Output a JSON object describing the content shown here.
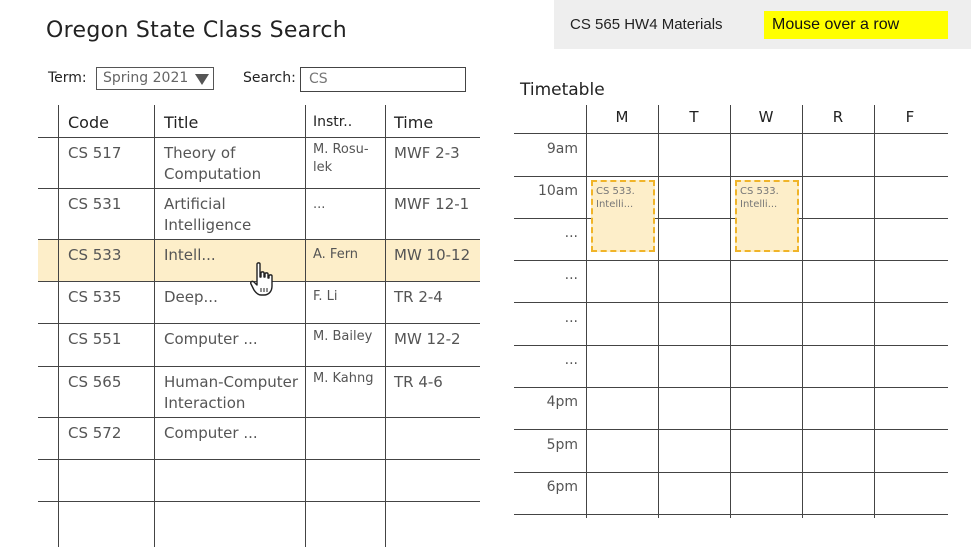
{
  "app": {
    "title": "Oregon State Class Search"
  },
  "info": {
    "hw_label": "CS 565 HW4 Materials",
    "hint": "Mouse over a row"
  },
  "filters": {
    "term_label": "Term:",
    "term_value": "Spring 2021",
    "search_label": "Search:",
    "search_value": "CS"
  },
  "table": {
    "headers": [
      "Code",
      "Title",
      "Instr..",
      "Time"
    ],
    "rows": [
      {
        "code": "CS 517",
        "title_1": "Theory of",
        "title_2": "Computation",
        "instr_1": "M. Rosu-",
        "instr_2": "lek",
        "time": "MWF 2-3"
      },
      {
        "code": "CS 531",
        "title_1": "Artificial",
        "title_2": "Intelligence",
        "instr_1": "...",
        "instr_2": "",
        "time": "MWF 12-1"
      },
      {
        "code": "CS 533",
        "title_1": "Intell...",
        "title_2": "",
        "instr_1": "A. Fern",
        "instr_2": "",
        "time": "MW 10-12"
      },
      {
        "code": "CS 535",
        "title_1": "Deep...",
        "title_2": "",
        "instr_1": "F. Li",
        "instr_2": "",
        "time": "TR 2-4"
      },
      {
        "code": "CS 551",
        "title_1": "Computer ...",
        "title_2": "",
        "instr_1": "M. Bailey",
        "instr_2": "",
        "time": "MW 12-2"
      },
      {
        "code": "CS 565",
        "title_1": "Human-Computer",
        "title_2": "Interaction",
        "instr_1": "M. Kahng",
        "instr_2": "",
        "time": "TR 4-6"
      },
      {
        "code": "CS 572",
        "title_1": "Computer ...",
        "title_2": "",
        "instr_1": "",
        "instr_2": "",
        "time": ""
      }
    ],
    "highlighted_row": 2
  },
  "timetable": {
    "title": "Timetable",
    "days": [
      "M",
      "T",
      "W",
      "R",
      "F"
    ],
    "times": [
      "9am",
      "10am",
      "...",
      "...",
      "...",
      "...",
      "4pm",
      "5pm",
      "6pm"
    ],
    "events": [
      {
        "day": "M",
        "line_1": "CS 533.",
        "line_2": "Intelli..."
      },
      {
        "day": "W",
        "line_1": "CS 533.",
        "line_2": "Intelli..."
      }
    ]
  },
  "colors": {
    "highlight": "#fdeec9",
    "event_border": "#f0b429",
    "hint_bg": "#ffff00",
    "panel_bg": "#eeeeee"
  },
  "icons": {
    "cursor": "hand-pointer-icon",
    "dropdown": "triangle-down-icon"
  }
}
